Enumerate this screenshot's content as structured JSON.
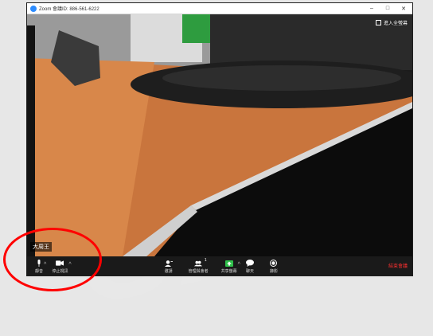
{
  "window": {
    "title": "Zoom 會議ID: 886-561-6222",
    "controls": [
      "–",
      "□",
      "✕"
    ]
  },
  "video": {
    "fullscreen_label": "進入全螢幕",
    "participant_name": "大周王"
  },
  "toolbar": {
    "mute_label": "靜音",
    "stop_video_label": "停止視訊",
    "invite_label": "邀請",
    "manage_participants_label": "管理與會者",
    "participants_count": "1",
    "share_screen_label": "共享螢幕",
    "chat_label": "聊天",
    "record_label": "錄影",
    "end_meeting_label": "結束會議",
    "caret": "^"
  },
  "colors": {
    "toolbar_bg": "#1a1a1a",
    "share_green": "#2fbf4a",
    "end_red": "#ff3030",
    "annotation_ring": "#ff0000"
  },
  "icons": [
    "zoom-app-icon",
    "fullscreen-icon",
    "microphone-icon",
    "video-camera-icon",
    "invite-icon",
    "participants-icon",
    "share-screen-icon",
    "chat-icon",
    "record-icon"
  ]
}
